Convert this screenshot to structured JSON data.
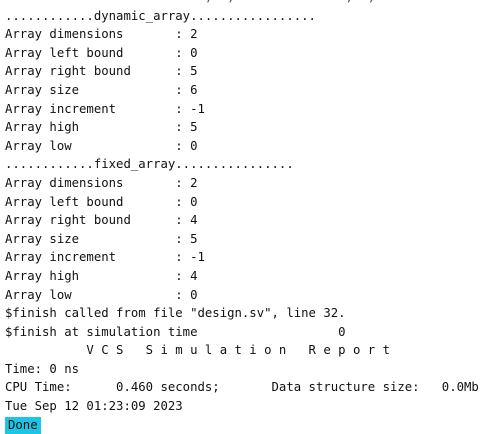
{
  "console": {
    "lines": [
      "                           ,  ,               ,  ,",
      "............dynamic_array.................",
      "Array dimensions       : 2",
      "Array left bound       : 0",
      "Array right bound      : 5",
      "Array size             : 6",
      "Array increment        : -1",
      "Array high             : 5",
      "Array low              : 0",
      "............fixed_array................",
      "Array dimensions       : 2",
      "Array left bound       : 0",
      "Array right bound      : 4",
      "Array size             : 5",
      "Array increment        : -1",
      "Array high             : 4",
      "Array low              : 0",
      "$finish called from file \"design.sv\", line 32.",
      "$finish at simulation time                   0",
      "           V C S   S i m u l a t i o n   R e p o r t",
      "Time: 0 ns",
      "CPU Time:      0.460 seconds;       Data structure size:   0.0Mb",
      "Tue Sep 12 01:23:09 2023"
    ],
    "status_badge": "Done"
  }
}
